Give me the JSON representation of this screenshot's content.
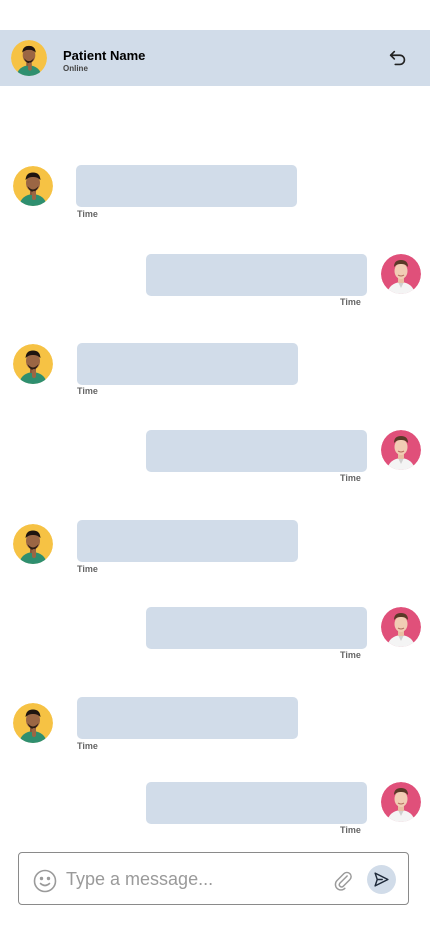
{
  "header": {
    "patient_name": "Patient Name",
    "status": "Online",
    "back_icon": "undo-arrow-icon"
  },
  "messages": [
    {
      "direction": "incoming",
      "time": "Time"
    },
    {
      "direction": "outgoing",
      "time": "Time"
    },
    {
      "direction": "incoming",
      "time": "Time"
    },
    {
      "direction": "outgoing",
      "time": "Time"
    },
    {
      "direction": "incoming",
      "time": "Time"
    },
    {
      "direction": "outgoing",
      "time": "Time"
    },
    {
      "direction": "incoming",
      "time": "Time"
    },
    {
      "direction": "outgoing",
      "time": "Time"
    }
  ],
  "composer": {
    "placeholder": "Type a message...",
    "emoji_icon": "smiley-icon",
    "attach_icon": "paperclip-icon",
    "send_icon": "send-icon"
  },
  "colors": {
    "header_bg": "#d1dce9",
    "bubble_bg": "#d1dce9",
    "patient_avatar_bg": "#f6c244",
    "doctor_avatar_bg": "#e0507a"
  }
}
